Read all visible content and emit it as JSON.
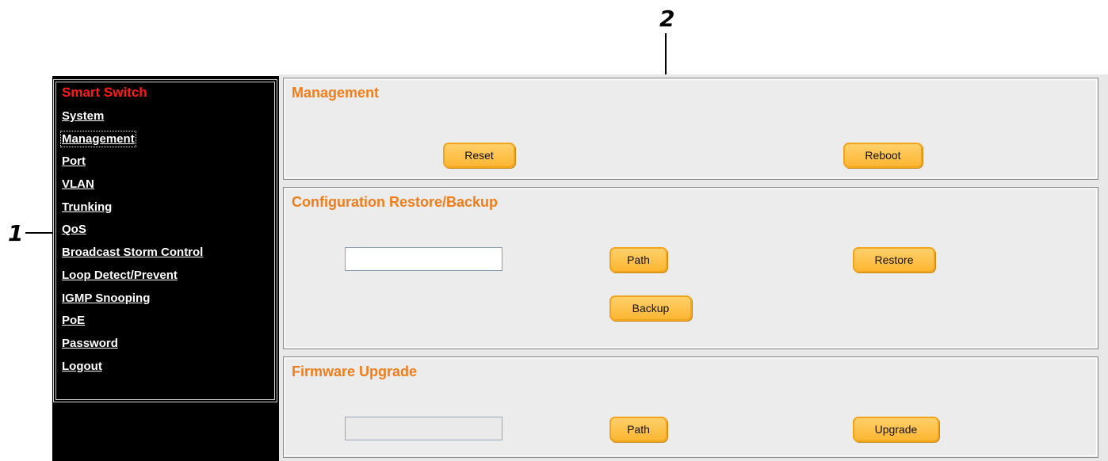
{
  "callouts": {
    "one": "1",
    "two": "2"
  },
  "sidebar": {
    "brand": "Smart Switch",
    "items": [
      {
        "label": "System"
      },
      {
        "label": "Management"
      },
      {
        "label": "Port"
      },
      {
        "label": "VLAN"
      },
      {
        "label": "Trunking"
      },
      {
        "label": "QoS"
      },
      {
        "label": "Broadcast Storm Control"
      },
      {
        "label": "Loop Detect/Prevent"
      },
      {
        "label": "IGMP Snooping"
      },
      {
        "label": "PoE"
      },
      {
        "label": "Password"
      },
      {
        "label": "Logout"
      }
    ],
    "active": "Management"
  },
  "management": {
    "title": "Management",
    "reset_label": "Reset",
    "reboot_label": "Reboot"
  },
  "config": {
    "title": "Configuration Restore/Backup",
    "file_value": "",
    "path_label": "Path",
    "restore_label": "Restore",
    "backup_label": "Backup"
  },
  "firmware": {
    "title": "Firmware Upgrade",
    "file_value": "",
    "path_label": "Path",
    "upgrade_label": "Upgrade"
  },
  "colors": {
    "accent": "#f07d1a",
    "brand": "#ff1a1a",
    "button": "#fdb632",
    "sidebar_bg": "#000000"
  }
}
